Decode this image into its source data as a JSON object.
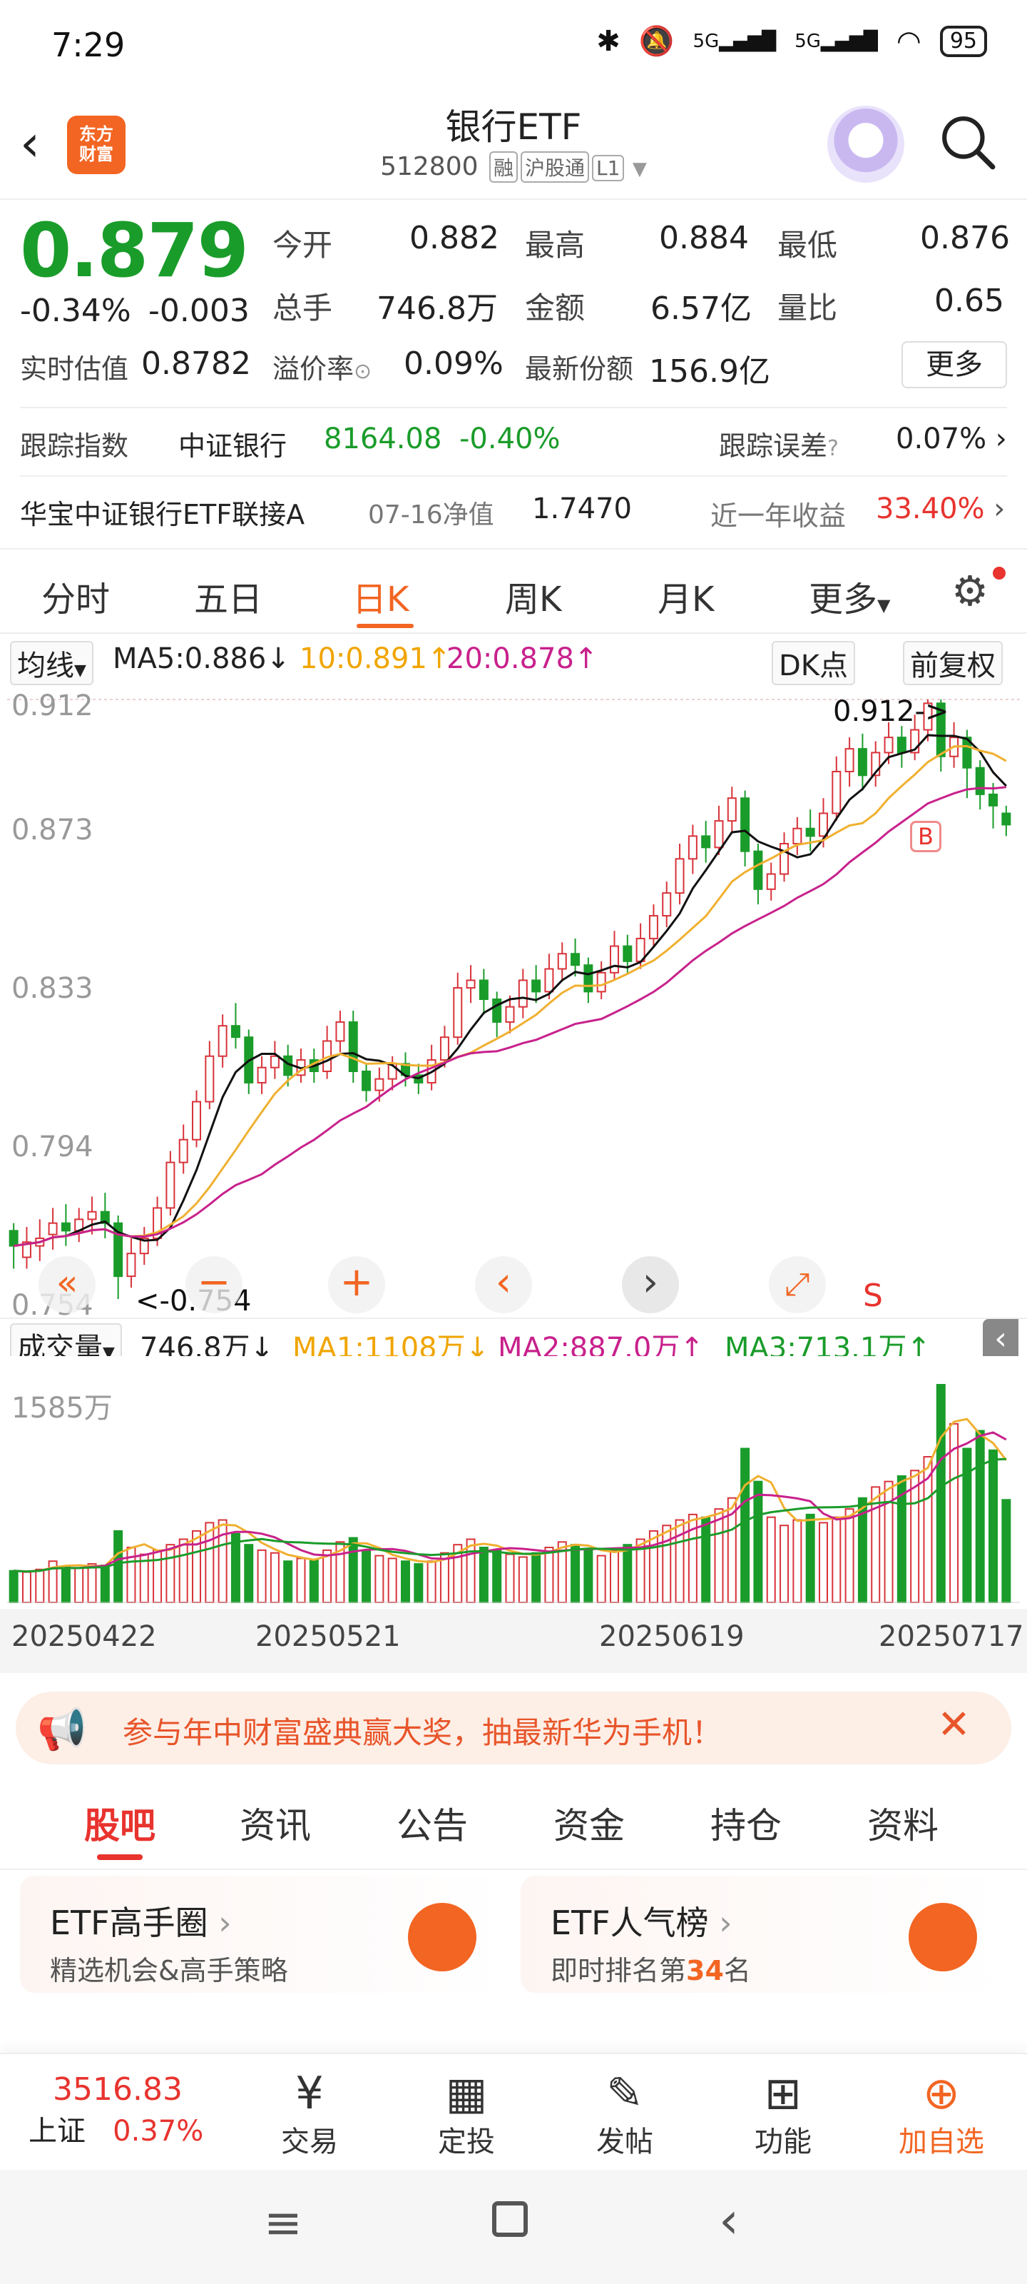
{
  "status_bar": {
    "time": "7:29",
    "signal1": "5G",
    "signal2": "5G",
    "battery": "95"
  },
  "header": {
    "app_logo": "东方\n财富",
    "title": "银行ETF",
    "code": "512800",
    "tags": [
      "融",
      "沪股通",
      "L1"
    ]
  },
  "quote": {
    "price": "0.879",
    "change_pct": "-0.34%",
    "change": "-0.003",
    "open_label": "今开",
    "open": "0.882",
    "high_label": "最高",
    "high": "0.884",
    "low_label": "最低",
    "low": "0.876",
    "vol_label": "总手",
    "vol": "746.8万",
    "amount_label": "金额",
    "amount": "6.57亿",
    "ratio_label": "量比",
    "ratio": "0.65",
    "iopv_label": "实时估值",
    "iopv": "0.8782",
    "premium_label": "溢价率",
    "premium": "0.09%",
    "shares_label": "最新份额",
    "shares": "156.9亿",
    "more": "更多"
  },
  "tracking": {
    "label": "跟踪指数",
    "index": "中证银行",
    "index_value": "8164.08",
    "index_change": "-0.40%",
    "err_label": "跟踪误差",
    "err": "0.07%",
    "fund": "华宝中证银行ETF联接A",
    "nav_label": "07-16净值",
    "nav": "1.7470",
    "yr_label": "近一年收益",
    "yr": "33.40%"
  },
  "ktabs": [
    "分时",
    "五日",
    "日K",
    "周K",
    "月K",
    "更多"
  ],
  "ma_row": {
    "type": "均线",
    "ma5": "MA5:0.886",
    "ma10": "10:0.891",
    "ma20": "20:0.878",
    "dk": "DK点",
    "adj": "前复权"
  },
  "kchart_labels": {
    "y1": "0.912",
    "y2": "0.873",
    "y3": "0.833",
    "y4": "0.794",
    "y5": "0.754",
    "max_mark": "0.912->",
    "min_mark": "<-0.754",
    "b_mark": "B",
    "s_mark": "S"
  },
  "vol_row": {
    "label": "成交量",
    "vol": "746.8万",
    "ma1": "MA1:1108万",
    "ma2": "MA2:887.0万",
    "ma3": "MA3:713.1万",
    "ymax": "1585万"
  },
  "dates": [
    "20250422",
    "20250521",
    "20250619",
    "20250717"
  ],
  "chart_data": {
    "type": "candlestick",
    "ylim": [
      0.754,
      0.912
    ],
    "candles": [
      [
        0.772,
        0.768,
        0.774,
        0.762
      ],
      [
        0.765,
        0.769,
        0.773,
        0.762
      ],
      [
        0.768,
        0.77,
        0.775,
        0.764
      ],
      [
        0.771,
        0.774,
        0.778,
        0.767
      ],
      [
        0.774,
        0.772,
        0.779,
        0.768
      ],
      [
        0.772,
        0.775,
        0.778,
        0.769
      ],
      [
        0.775,
        0.777,
        0.781,
        0.771
      ],
      [
        0.777,
        0.774,
        0.782,
        0.77
      ],
      [
        0.774,
        0.76,
        0.776,
        0.754
      ],
      [
        0.76,
        0.766,
        0.77,
        0.757
      ],
      [
        0.766,
        0.77,
        0.773,
        0.763
      ],
      [
        0.77,
        0.778,
        0.781,
        0.768
      ],
      [
        0.778,
        0.79,
        0.793,
        0.776
      ],
      [
        0.79,
        0.796,
        0.8,
        0.787
      ],
      [
        0.796,
        0.806,
        0.809,
        0.794
      ],
      [
        0.806,
        0.818,
        0.822,
        0.804
      ],
      [
        0.818,
        0.826,
        0.829,
        0.815
      ],
      [
        0.826,
        0.823,
        0.832,
        0.82
      ],
      [
        0.823,
        0.811,
        0.825,
        0.808
      ],
      [
        0.811,
        0.815,
        0.818,
        0.808
      ],
      [
        0.815,
        0.818,
        0.822,
        0.812
      ],
      [
        0.818,
        0.813,
        0.821,
        0.81
      ],
      [
        0.813,
        0.817,
        0.82,
        0.811
      ],
      [
        0.817,
        0.814,
        0.82,
        0.811
      ],
      [
        0.814,
        0.822,
        0.826,
        0.812
      ],
      [
        0.822,
        0.827,
        0.83,
        0.819
      ],
      [
        0.827,
        0.814,
        0.83,
        0.811
      ],
      [
        0.814,
        0.809,
        0.816,
        0.806
      ],
      [
        0.809,
        0.812,
        0.815,
        0.806
      ],
      [
        0.812,
        0.816,
        0.818,
        0.809
      ],
      [
        0.816,
        0.813,
        0.819,
        0.81
      ],
      [
        0.813,
        0.811,
        0.816,
        0.808
      ],
      [
        0.811,
        0.817,
        0.821,
        0.809
      ],
      [
        0.817,
        0.823,
        0.826,
        0.815
      ],
      [
        0.823,
        0.836,
        0.84,
        0.821
      ],
      [
        0.836,
        0.838,
        0.842,
        0.832
      ],
      [
        0.838,
        0.833,
        0.841,
        0.829
      ],
      [
        0.833,
        0.827,
        0.835,
        0.823
      ],
      [
        0.827,
        0.831,
        0.834,
        0.824
      ],
      [
        0.831,
        0.838,
        0.841,
        0.828
      ],
      [
        0.838,
        0.835,
        0.842,
        0.832
      ],
      [
        0.835,
        0.841,
        0.845,
        0.833
      ],
      [
        0.841,
        0.845,
        0.848,
        0.838
      ],
      [
        0.845,
        0.842,
        0.849,
        0.839
      ],
      [
        0.842,
        0.835,
        0.844,
        0.832
      ],
      [
        0.835,
        0.84,
        0.843,
        0.833
      ],
      [
        0.84,
        0.847,
        0.851,
        0.838
      ],
      [
        0.847,
        0.843,
        0.85,
        0.84
      ],
      [
        0.843,
        0.849,
        0.853,
        0.841
      ],
      [
        0.849,
        0.855,
        0.858,
        0.847
      ],
      [
        0.855,
        0.861,
        0.864,
        0.852
      ],
      [
        0.861,
        0.87,
        0.874,
        0.858
      ],
      [
        0.87,
        0.876,
        0.879,
        0.866
      ],
      [
        0.876,
        0.873,
        0.88,
        0.869
      ],
      [
        0.873,
        0.88,
        0.884,
        0.871
      ],
      [
        0.88,
        0.886,
        0.889,
        0.877
      ],
      [
        0.886,
        0.872,
        0.888,
        0.868
      ],
      [
        0.872,
        0.862,
        0.874,
        0.858
      ],
      [
        0.862,
        0.866,
        0.869,
        0.859
      ],
      [
        0.866,
        0.874,
        0.877,
        0.864
      ],
      [
        0.874,
        0.878,
        0.881,
        0.871
      ],
      [
        0.878,
        0.876,
        0.883,
        0.872
      ],
      [
        0.876,
        0.882,
        0.886,
        0.873
      ],
      [
        0.882,
        0.893,
        0.897,
        0.88
      ],
      [
        0.893,
        0.899,
        0.902,
        0.889
      ],
      [
        0.899,
        0.892,
        0.903,
        0.888
      ],
      [
        0.892,
        0.898,
        0.901,
        0.889
      ],
      [
        0.898,
        0.902,
        0.906,
        0.895
      ],
      [
        0.902,
        0.898,
        0.905,
        0.894
      ],
      [
        0.898,
        0.904,
        0.908,
        0.896
      ],
      [
        0.904,
        0.911,
        0.912,
        0.901
      ],
      [
        0.911,
        0.897,
        0.912,
        0.893
      ],
      [
        0.897,
        0.902,
        0.906,
        0.894
      ],
      [
        0.902,
        0.894,
        0.904,
        0.886
      ],
      [
        0.894,
        0.887,
        0.896,
        0.883
      ],
      [
        0.887,
        0.884,
        0.89,
        0.878
      ],
      [
        0.882,
        0.879,
        0.884,
        0.876
      ]
    ],
    "volumes": [
      230,
      220,
      240,
      300,
      260,
      250,
      280,
      270,
      520,
      400,
      350,
      380,
      420,
      460,
      520,
      580,
      600,
      500,
      420,
      380,
      360,
      300,
      320,
      310,
      380,
      440,
      470,
      380,
      340,
      320,
      300,
      280,
      300,
      360,
      420,
      460,
      400,
      380,
      350,
      330,
      360,
      400,
      440,
      420,
      380,
      340,
      380,
      420,
      460,
      520,
      560,
      600,
      640,
      620,
      680,
      760,
      1120,
      880,
      620,
      560,
      600,
      640,
      580,
      620,
      680,
      760,
      840,
      880,
      920,
      960,
      1060,
      1585,
      1300,
      1120,
      1250,
      1108,
      746.8
    ]
  },
  "banner": {
    "text": "参与年中财富盛典赢大奖，抽最新华为手机！"
  },
  "content_tabs": [
    "股吧",
    "资讯",
    "公告",
    "资金",
    "持仓",
    "资料"
  ],
  "cards": [
    {
      "title": "ETF高手圈",
      "sub": "精选机会&高手策略"
    },
    {
      "title": "ETF人气榜",
      "sub_pre": "即时排名第",
      "rank": "34",
      "sub_post": "名"
    }
  ],
  "bottom_nav": {
    "index_value": "3516.83",
    "index_name": "上证",
    "index_change": "0.37%",
    "items": [
      "交易",
      "定投",
      "发帖",
      "功能",
      "加自选"
    ]
  }
}
